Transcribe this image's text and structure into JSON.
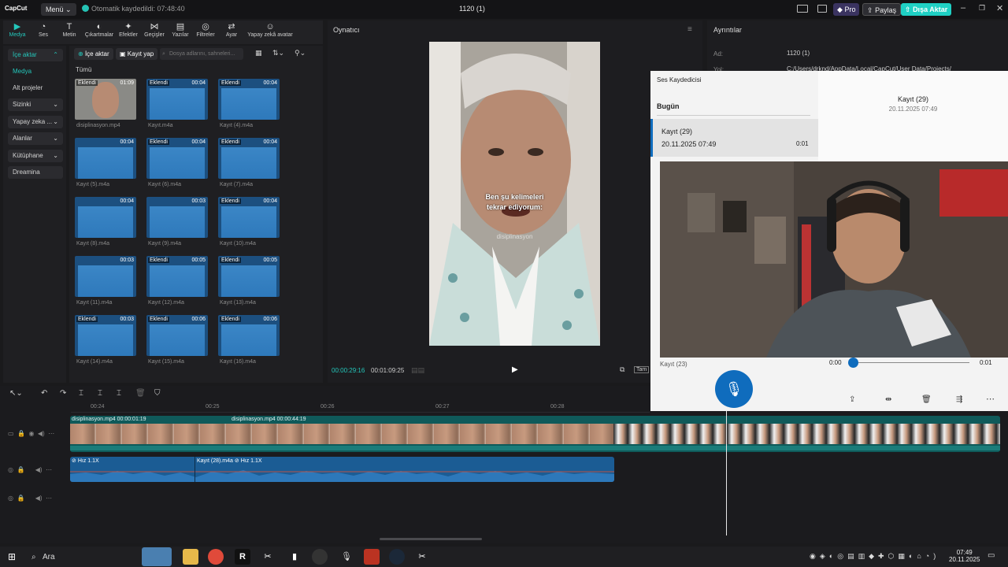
{
  "app": {
    "logo": "CapCut",
    "menu_label": "Menü",
    "autosave_text": "Otomatik kaydedildi: 07:48:40",
    "project_title": "1120 (1)",
    "pro_label": "Pro",
    "share_label": "Paylaş",
    "export_label": "Dışa Aktar"
  },
  "tools": [
    {
      "label": "Medya",
      "icon": "▶"
    },
    {
      "label": "Ses",
      "icon": "◔"
    },
    {
      "label": "Metin",
      "icon": "T"
    },
    {
      "label": "Çıkartmalar",
      "icon": "◐"
    },
    {
      "label": "Efektler",
      "icon": "✦"
    },
    {
      "label": "Geçişler",
      "icon": "⋈"
    },
    {
      "label": "Yazılar",
      "icon": "▤"
    },
    {
      "label": "Filtreler",
      "icon": "◎"
    },
    {
      "label": "Ayar",
      "icon": "⇄"
    },
    {
      "label": "Yapay zekâ avatar",
      "icon": "☺"
    }
  ],
  "sidebar": {
    "items": [
      {
        "label": "İçe aktar"
      },
      {
        "label": "Medya"
      },
      {
        "label": "Alt projeler"
      },
      {
        "label": "Sizinki"
      },
      {
        "label": "Yapay zeka ..."
      },
      {
        "label": "Alanlar"
      },
      {
        "label": "Kütüphane"
      },
      {
        "label": "Dreamina"
      }
    ]
  },
  "media": {
    "import_label": "İçe aktar",
    "record_label": "Kayıt yap",
    "search_placeholder": "Dosya adlarını, sahneleri...",
    "filter_all": "Tümü",
    "items": [
      {
        "name": "disiplinasyon.mp4",
        "duration": "01:09",
        "tag": "Eklendi",
        "video": true
      },
      {
        "name": "Kayıt.m4a",
        "duration": "00:04",
        "tag": "Eklendi"
      },
      {
        "name": "Kayıt (4).m4a",
        "duration": "00:04",
        "tag": "Eklendi"
      },
      {
        "name": "Kayıt (5).m4a",
        "duration": "00:04",
        "tag": ""
      },
      {
        "name": "Kayıt (6).m4a",
        "duration": "00:04",
        "tag": "Eklendi"
      },
      {
        "name": "Kayıt (7).m4a",
        "duration": "00:04",
        "tag": "Eklendi"
      },
      {
        "name": "Kayıt (8).m4a",
        "duration": "00:04",
        "tag": ""
      },
      {
        "name": "Kayıt (9).m4a",
        "duration": "00:03",
        "tag": ""
      },
      {
        "name": "Kayıt (10).m4a",
        "duration": "00:04",
        "tag": "Eklendi"
      },
      {
        "name": "Kayıt (11).m4a",
        "duration": "00:03",
        "tag": ""
      },
      {
        "name": "Kayıt (12).m4a",
        "duration": "00:05",
        "tag": "Eklendi"
      },
      {
        "name": "Kayıt (13).m4a",
        "duration": "00:05",
        "tag": "Eklendi"
      },
      {
        "name": "Kayıt (14).m4a",
        "duration": "00:03",
        "tag": "Eklendi"
      },
      {
        "name": "Kayıt (15).m4a",
        "duration": "00:06",
        "tag": "Eklendi"
      },
      {
        "name": "Kayıt (16).m4a",
        "duration": "00:06",
        "tag": "Eklendi"
      }
    ]
  },
  "player": {
    "title": "Oynatıcı",
    "caption_line1": "Ben şu kelimeleri",
    "caption_line2": "tekrar ediyorum:",
    "watermark": "disiplinasyon",
    "current_time": "00:00:29:16",
    "total_time": "00:01:09:25",
    "fullscreen_label": "Tam"
  },
  "details": {
    "title": "Ayrıntılar",
    "name_label": "Ad:",
    "name_value": "1120 (1)",
    "path_label": "Yol:",
    "path_value": "C:/Users/drknd/AppData/Local/CapCut/User Data/Projects/"
  },
  "timeline": {
    "ruler": [
      "00:24",
      "00:25",
      "00:26",
      "00:27",
      "00:28"
    ],
    "video_clip1": "disiplinasyon.mp4  00:00:01:19",
    "video_clip2": "disiplinasyon.mp4  00:00:44:19",
    "audio_speed1": "Hız 1.1X",
    "audio_clip2": "Kayıt (28).m4a",
    "audio_speed2": "Hız 1.1X"
  },
  "recorder": {
    "title": "Ses Kaydedicisi",
    "section_today": "Bugün",
    "item_name": "Kayıt (29)",
    "item_date": "20.11.2025 07:49",
    "item_duration": "0:01",
    "detail_name": "Kayıt (29)",
    "detail_date": "20.11.2025 07:49",
    "partial_item": "Kayıt (23)",
    "time_start": "0:00",
    "time_end": "0:01",
    "progress": 0
  },
  "taskbar": {
    "search_label": "Ara",
    "clock_time": "07:49",
    "clock_date": "20.11.2025"
  },
  "colors": {
    "accent": "#24c7bb",
    "export": "#1fd0c4",
    "audio_clip": "#1b5c94",
    "video_clip": "#0f5a5a",
    "recorder_accent": "#0f6cbd"
  }
}
